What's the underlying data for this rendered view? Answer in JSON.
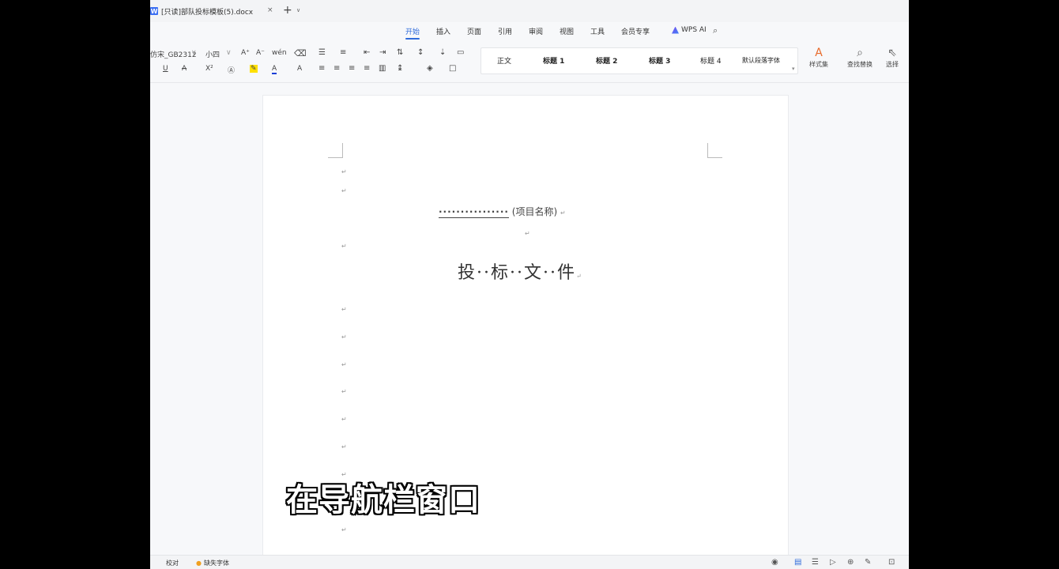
{
  "tab": {
    "title": "[只读]部队投标模板(5).docx",
    "app_letter": "W"
  },
  "menu": [
    "开始",
    "插入",
    "页面",
    "引用",
    "审阅",
    "视图",
    "工具",
    "会员专享"
  ],
  "wps_ai": "WPS AI",
  "ribbon": {
    "font_name": "仿宋_GB2312",
    "font_size": "小四",
    "font_size_up": "A⁺",
    "font_size_down": "A⁻",
    "phonetic": "wén",
    "styles": [
      "正文",
      "标题 1",
      "标题 2",
      "标题 3",
      "标题 4",
      "默认段落字体"
    ],
    "style_set": "样式集",
    "find_replace": "查找替换",
    "select": "选择"
  },
  "document": {
    "project_line_dots": "················",
    "project_label": "(项目名称)",
    "title": "投··标··文··件"
  },
  "subtitle": "在导航栏窗口",
  "status": {
    "proof": "校对",
    "missing_font": "缺失字体"
  }
}
